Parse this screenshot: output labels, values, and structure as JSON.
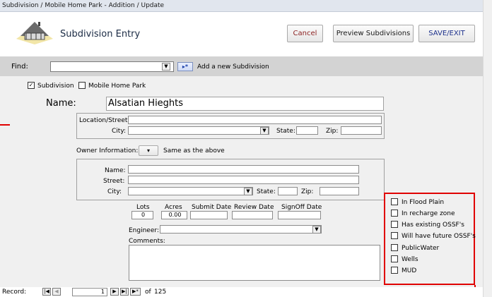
{
  "window": {
    "title": "Subdivision / Mobile Home Park - Addition / Update"
  },
  "header": {
    "title": "Subdivision Entry",
    "cancel_label": "Cancel",
    "preview_label": "Preview Subdivisions",
    "save_label": "SAVE/EXIT"
  },
  "find": {
    "label": "Find:",
    "value": "",
    "add_new_icon": "▸*",
    "add_new_label": "Add a new Subdivision"
  },
  "type": {
    "subdivision_label": "Subdivision",
    "subdivision_mark": "✓",
    "mobile_home_label": "Mobile Home Park"
  },
  "name": {
    "label": "Name:",
    "value": "Alsatian Hieghts"
  },
  "location": {
    "street_label": "Location/Street:",
    "city_label": "City:",
    "state_label": "State:",
    "zip_label": "Zip:"
  },
  "owner": {
    "label": "Owner Information:",
    "same_label": "Same as the above",
    "name_label": "Name:",
    "street_label": "Street:",
    "city_label": "City:",
    "state_label": "State:",
    "zip_label": "Zip:"
  },
  "stats": {
    "lots_label": "Lots",
    "lots_value": "0",
    "acres_label": "Acres",
    "acres_value": "0.00",
    "submit_label": "Submit Date",
    "review_label": "Review Date",
    "signoff_label": "SignOff Date"
  },
  "engineer_label": "Engineer:",
  "comments_label": "Comments:",
  "flags": [
    "In Flood Plain",
    "In recharge zone",
    "Has existing OSSF's",
    "Will have future OSSF's",
    "PublicWater",
    "Wells",
    "MUD"
  ],
  "record_nav": {
    "label": "Record:",
    "current": "1",
    "of_label": "of",
    "total": "125"
  },
  "colors": {
    "highlight_red": "#e00000",
    "form_bg": "#f0f0f0",
    "toolbar_gray": "#d3d3d3"
  }
}
